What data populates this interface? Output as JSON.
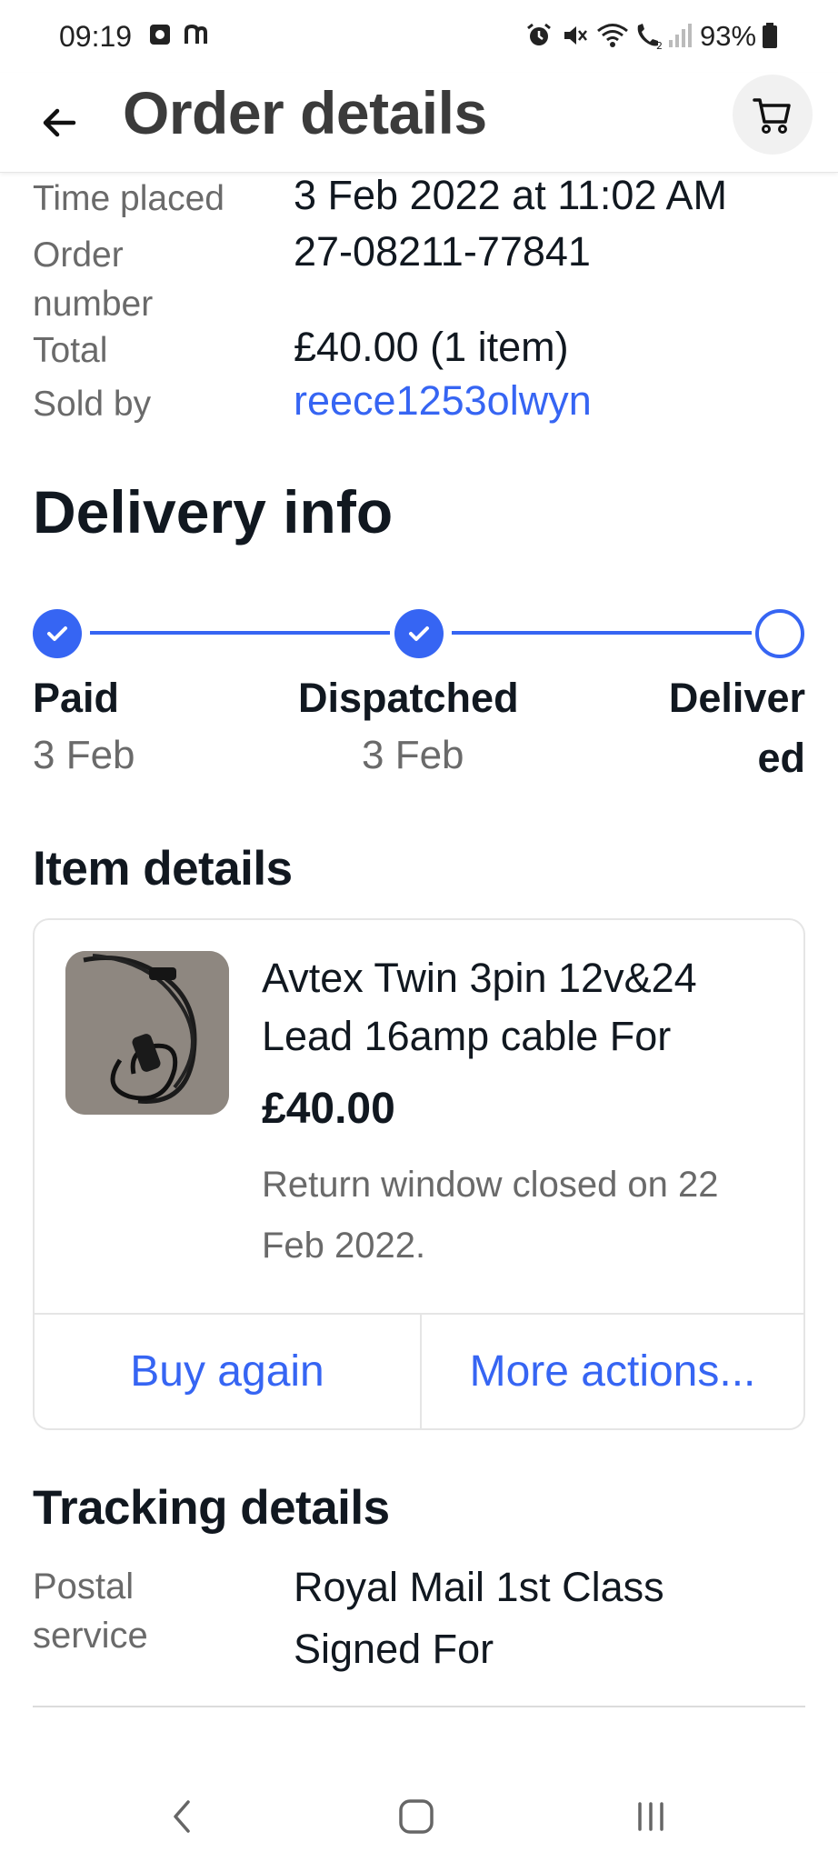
{
  "status_bar": {
    "time": "09:19",
    "battery": "93%",
    "icons": [
      "screen-record-icon",
      "notification-n-icon",
      "alarm-icon",
      "mute-icon",
      "wifi-icon",
      "wifi-calling-icon",
      "signal-icon",
      "battery-icon"
    ]
  },
  "header": {
    "title": "Order details",
    "back_icon": "arrow-left-icon",
    "cart_icon": "cart-icon"
  },
  "summary": {
    "time_placed_label": "Time placed",
    "time_placed_value": "3 Feb 2022 at 11:02 AM",
    "order_number_label_1": "Order",
    "order_number_label_2": "number",
    "order_number_value": "27-08211-77841",
    "total_label": "Total",
    "total_value": "£40.00 (1 item)",
    "sold_by_label": "Sold by",
    "sold_by_value": "reece1253olwyn"
  },
  "delivery": {
    "title": "Delivery info",
    "steps": [
      {
        "label": "Paid",
        "date": "3 Feb",
        "status": "done"
      },
      {
        "label": "Dispatched",
        "date": "3 Feb",
        "status": "done"
      },
      {
        "label_line1": "Deliver",
        "label_line2": "ed",
        "status": "pending"
      }
    ],
    "accent_color": "#3665f3"
  },
  "items": {
    "title": "Item details",
    "item": {
      "title": "Avtex Twin 3pin 12v&24 Lead 16amp cable For",
      "price": "£40.00",
      "return_note": "Return window closed on 22 Feb 2022."
    },
    "buy_again": "Buy again",
    "more_actions": "More actions..."
  },
  "tracking": {
    "title": "Tracking details",
    "postal_label_1": "Postal",
    "postal_label_2": "service",
    "postal_value": "Royal Mail 1st Class Signed For"
  },
  "nav_bar": {
    "icons": [
      "nav-back-icon",
      "nav-home-icon",
      "nav-recents-icon"
    ]
  }
}
